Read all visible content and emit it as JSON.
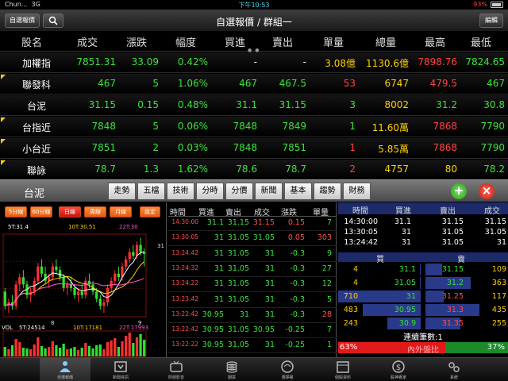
{
  "status_bar": {
    "carrier": "Chun...",
    "network": "3G",
    "time": "下午10:53",
    "battery": "93%"
  },
  "nav": {
    "left_button": "自選報價",
    "title": "自選報價 / 群組一",
    "right_button": "編輯"
  },
  "table": {
    "headers": [
      "股名",
      "成交",
      "漲跌",
      "幅度",
      "買進",
      "賣出",
      "單量",
      "總量",
      "最高",
      "最低"
    ],
    "rows": [
      {
        "name": "加權指",
        "flag": false,
        "cells": [
          "7851.31",
          "33.09",
          "0.42%",
          "-",
          "-",
          "3.08億",
          "1130.6億",
          "7898.76",
          "7824.65"
        ]
      },
      {
        "name": "聯發科",
        "flag": true,
        "cells": [
          "467",
          "5",
          "1.06%",
          "467",
          "467.5",
          "53",
          "6747",
          "479.5",
          "467"
        ]
      },
      {
        "name": "台泥",
        "flag": false,
        "cells": [
          "31.15",
          "0.15",
          "0.48%",
          "31.1",
          "31.15",
          "3",
          "8002",
          "31.2",
          "30.8"
        ]
      },
      {
        "name": "台指近",
        "flag": true,
        "cells": [
          "7848",
          "5",
          "0.06%",
          "7848",
          "7849",
          "1",
          "11.60萬",
          "7868",
          "7790"
        ]
      },
      {
        "name": "小台近",
        "flag": true,
        "cells": [
          "7851",
          "2",
          "0.03%",
          "7848",
          "7851",
          "1",
          "5.85萬",
          "7868",
          "7790"
        ]
      },
      {
        "name": "聯詠",
        "flag": true,
        "cells": [
          "78.7",
          "1.3",
          "1.62%",
          "78.6",
          "78.7",
          "2",
          "4757",
          "80",
          "78.2"
        ]
      }
    ]
  },
  "toolbar": {
    "stock": "台泥",
    "buttons": [
      "走勢",
      "五檔",
      "技術",
      "分時",
      "分價",
      "新聞",
      "基本",
      "趨勢",
      "財務"
    ],
    "add": "+",
    "close": "×"
  },
  "chart_panel": {
    "periods": [
      "5分線",
      "60分線",
      "日線",
      "周線",
      "月線"
    ],
    "active_period": "日線",
    "set_button": "設定",
    "ma_labels": [
      "5T:31.4",
      "10T:30.51",
      "22T:30"
    ],
    "right_scale": "31",
    "x_labels": [
      "8",
      "9"
    ],
    "vol_labels": [
      "VOL",
      "5T:24514",
      "10T:17181",
      "22T:17993"
    ],
    "colors": {
      "ma5": "#ffffff",
      "ma10": "#ffd000",
      "ma22": "#ff5ad0"
    }
  },
  "chart_data": {
    "type": "candlestick",
    "title": "",
    "x_labels": [
      "8",
      "9"
    ],
    "candles": [
      [
        30.1,
        30.2,
        29.6,
        29.7
      ],
      [
        29.7,
        29.9,
        29.5,
        29.8
      ],
      [
        29.8,
        30.0,
        29.6,
        29.7
      ],
      [
        29.7,
        30.4,
        29.6,
        30.3
      ],
      [
        30.3,
        30.6,
        30.1,
        30.5
      ],
      [
        30.5,
        30.7,
        30.2,
        30.3
      ],
      [
        30.3,
        30.4,
        29.9,
        30.0
      ],
      [
        30.0,
        30.2,
        29.8,
        30.1
      ],
      [
        30.1,
        30.5,
        30.0,
        30.4
      ],
      [
        30.4,
        30.9,
        30.3,
        30.8
      ],
      [
        30.8,
        31.0,
        30.5,
        30.6
      ],
      [
        30.6,
        30.8,
        30.3,
        30.4
      ],
      [
        30.4,
        30.6,
        30.2,
        30.5
      ],
      [
        30.5,
        30.9,
        30.4,
        30.8
      ],
      [
        30.8,
        31.0,
        30.6,
        30.7
      ],
      [
        30.7,
        30.8,
        30.4,
        30.5
      ],
      [
        30.5,
        30.6,
        30.1,
        30.2
      ],
      [
        30.2,
        30.4,
        30.0,
        30.3
      ],
      [
        30.3,
        30.5,
        30.1,
        30.2
      ],
      [
        30.2,
        30.3,
        29.9,
        30.0
      ],
      [
        30.0,
        30.2,
        29.8,
        30.1
      ],
      [
        30.1,
        30.3,
        29.9,
        30.0
      ],
      [
        30.0,
        30.5,
        29.9,
        30.4
      ],
      [
        30.4,
        30.6,
        30.2,
        30.3
      ],
      [
        30.3,
        30.4,
        30.0,
        30.1
      ],
      [
        30.1,
        30.2,
        29.8,
        29.9
      ],
      [
        29.9,
        30.0,
        29.6,
        29.7
      ],
      [
        29.7,
        29.9,
        29.5,
        29.8
      ],
      [
        29.8,
        30.3,
        29.7,
        30.2
      ],
      [
        30.2,
        30.5,
        30.1,
        30.4
      ],
      [
        30.4,
        30.7,
        30.3,
        30.6
      ],
      [
        30.6,
        30.8,
        30.4,
        30.5
      ],
      [
        30.5,
        30.9,
        30.4,
        30.8
      ],
      [
        30.8,
        31.1,
        30.7,
        31.0
      ],
      [
        31.0,
        31.3,
        30.9,
        31.2
      ],
      [
        31.2,
        31.4,
        31.0,
        31.1
      ],
      [
        31.1,
        31.5,
        31.0,
        31.4
      ],
      [
        31.4,
        31.6,
        31.1,
        31.2
      ],
      [
        31.2,
        31.3,
        30.8,
        31.15
      ]
    ],
    "volumes": [
      12,
      9,
      14,
      22,
      18,
      11,
      10,
      9,
      15,
      24,
      13,
      10,
      12,
      19,
      14,
      11,
      16,
      9,
      10,
      12,
      8,
      11,
      17,
      13,
      10,
      14,
      15,
      9,
      18,
      20,
      23,
      12,
      19,
      26,
      30,
      17,
      24,
      28,
      21
    ],
    "ylim": [
      29.4,
      31.7
    ]
  },
  "ticks": {
    "headers": [
      "時間",
      "買進",
      "賣出",
      "成交",
      "漲跌",
      "單量"
    ],
    "rows": [
      [
        "14:30:00",
        "31.1",
        "31.15",
        "31.15",
        "0.15",
        "7"
      ],
      [
        "13:30:05",
        "31",
        "31.05",
        "31.05",
        "0.05",
        "303"
      ],
      [
        "13:24:42",
        "31",
        "31.05",
        "31",
        "-0.3",
        "9"
      ],
      [
        "13:24:32",
        "31",
        "31.05",
        "31",
        "-0.3",
        "27"
      ],
      [
        "13:24:22",
        "31",
        "31.05",
        "31",
        "-0.3",
        "12"
      ],
      [
        "13:23:42",
        "31",
        "31.05",
        "31",
        "-0.3",
        "5"
      ],
      [
        "13:22:42",
        "30.95",
        "31",
        "31",
        "-0.3",
        "28"
      ],
      [
        "13:22:42",
        "30.95",
        "31.05",
        "30.95",
        "-0.25",
        "7"
      ],
      [
        "13:22:22",
        "30.95",
        "31.05",
        "31",
        "-0.25",
        "1"
      ]
    ]
  },
  "book": {
    "headers": [
      "時間",
      "買進",
      "賣出",
      "成交"
    ],
    "recent": [
      [
        "14:30:00",
        "31.1",
        "31.15",
        "31.15"
      ],
      [
        "13:30:05",
        "31",
        "31.05",
        "31.05"
      ],
      [
        "13:24:42",
        "31",
        "31.05",
        "31"
      ]
    ],
    "bid_label": "買",
    "ask_label": "賣",
    "levels": [
      {
        "bid_qty": "4",
        "bid": "31.1",
        "ask": "31.15",
        "ask_qty": "109",
        "bid_fill": 0.01,
        "ask_fill": 0.2
      },
      {
        "bid_qty": "4",
        "bid": "31.05",
        "ask": "31.2",
        "ask_qty": "363",
        "bid_fill": 0.01,
        "ask_fill": 0.55
      },
      {
        "bid_qty": "710",
        "bid": "31",
        "ask": "31.25",
        "ask_qty": "117",
        "bid_fill": 1.0,
        "ask_fill": 0.22
      },
      {
        "bid_qty": "483",
        "bid": "30.95",
        "ask": "31.3",
        "ask_qty": "435",
        "bid_fill": 0.7,
        "ask_fill": 0.65
      },
      {
        "bid_qty": "243",
        "bid": "30.9",
        "ask": "31.35",
        "ask_qty": "255",
        "bid_fill": 0.4,
        "ask_fill": 0.42
      }
    ],
    "continuous": "連續筆數:1",
    "ratio_left": "63%",
    "ratio_label": "內外盤比",
    "ratio_right": "37%",
    "inner_ratio": 0.63
  },
  "tabbar": {
    "items": [
      "自選報價",
      "新聞資訊",
      "財經影音",
      "期貨",
      "選擇權",
      "個股資料",
      "股神專家",
      "系統"
    ],
    "active": 0
  }
}
